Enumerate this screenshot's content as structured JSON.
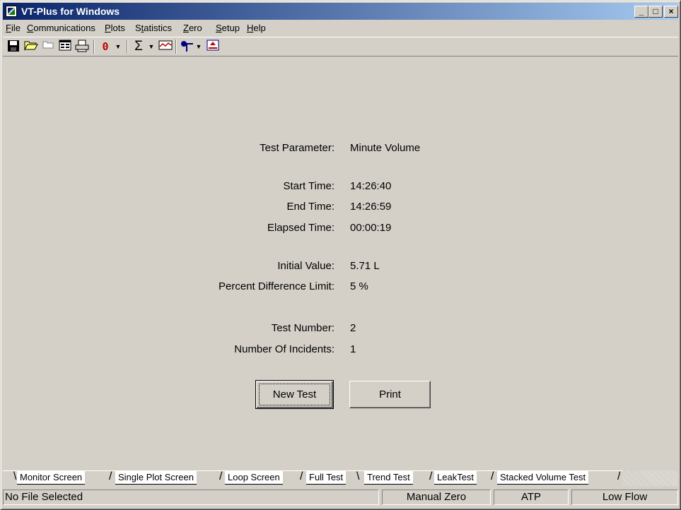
{
  "window": {
    "title": "VT-Plus for Windows",
    "minimize_glyph": "_",
    "maximize_glyph": "□",
    "close_glyph": "×"
  },
  "menu": [
    "File",
    "Communications",
    "Plots",
    "Statistics",
    "Zero",
    "Setup",
    "Help"
  ],
  "menu_underline": [
    "F",
    "C",
    "P",
    "t",
    "Z",
    "S",
    "H"
  ],
  "toolbar": {
    "zero_label": "0",
    "sigma_label": "Σ",
    "icons": [
      "save-icon",
      "open-folder-icon",
      "folder-icon",
      "form-view-icon",
      "print-icon",
      "zero-icon",
      "sum-icon",
      "chart-icon",
      "pointer-icon",
      "trigger-icon"
    ]
  },
  "report": {
    "test_parameter_label": "Test Parameter:",
    "test_parameter_value": "Minute Volume",
    "start_time_label": "Start Time:",
    "start_time_value": "14:26:40",
    "end_time_label": "End Time:",
    "end_time_value": "14:26:59",
    "elapsed_time_label": "Elapsed Time:",
    "elapsed_time_value": "00:00:19",
    "initial_value_label": "Initial Value:",
    "initial_value_value": "5.71 L",
    "percent_diff_label": "Percent Difference Limit:",
    "percent_diff_value": "5 %",
    "test_number_label": "Test Number:",
    "test_number_value": "2",
    "incidents_label": "Number Of Incidents:",
    "incidents_value": "1"
  },
  "buttons": {
    "new_test": "New Test",
    "print": "Print"
  },
  "tabs": [
    {
      "label": "Monitor Screen",
      "active": false
    },
    {
      "label": "Single Plot Screen",
      "active": false
    },
    {
      "label": "Loop Screen",
      "active": false
    },
    {
      "label": "Full Test",
      "active": false
    },
    {
      "label": "Trend Test",
      "active": true
    },
    {
      "label": "LeakTest",
      "active": false
    },
    {
      "label": "Stacked Volume Test",
      "active": false
    }
  ],
  "status": {
    "file": "No File Selected",
    "zero_mode": "Manual Zero",
    "gas_condition": "ATP",
    "flow_range": "Low Flow"
  }
}
